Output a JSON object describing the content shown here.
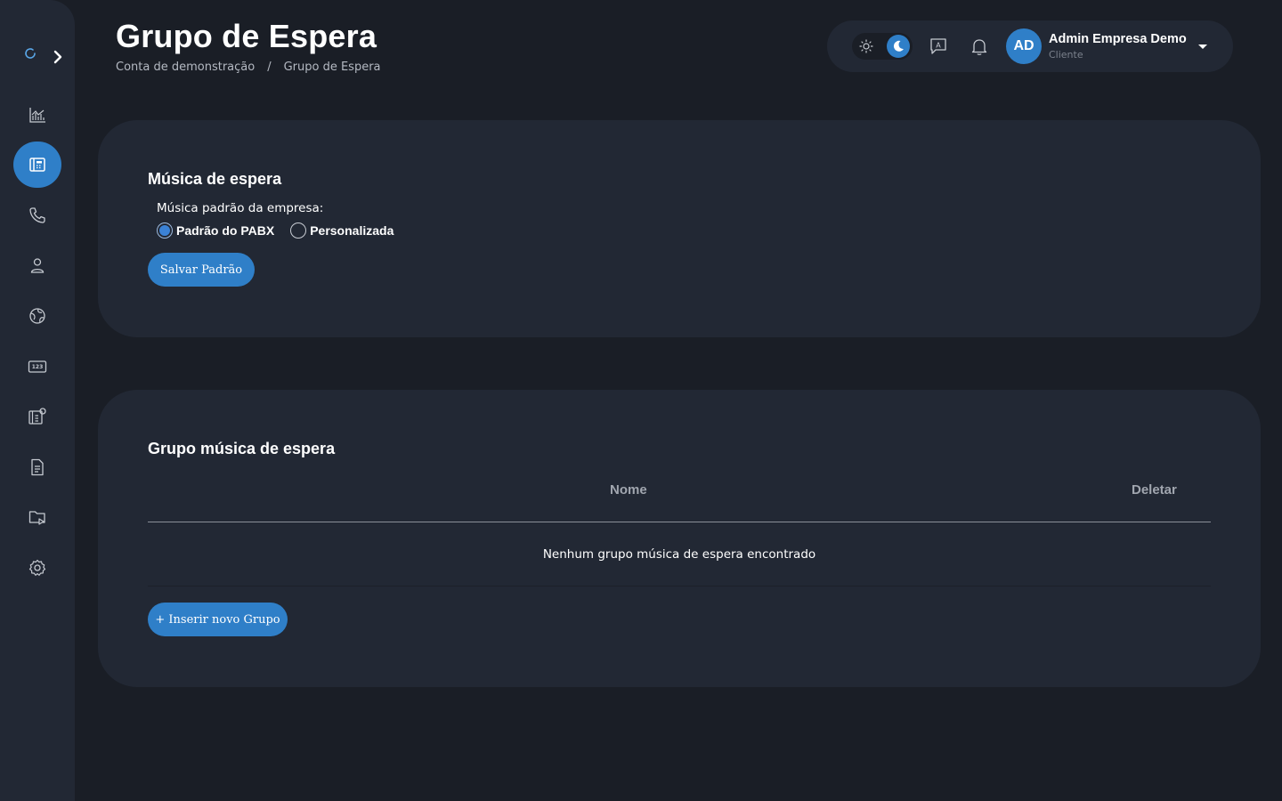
{
  "page": {
    "title": "Grupo de Espera",
    "breadcrumb": [
      "Conta de demonstração",
      "/",
      "Grupo de Espera"
    ]
  },
  "header": {
    "user": {
      "initials": "AD",
      "name": "Admin Empresa Demo",
      "role": "Cliente"
    },
    "theme": {
      "mode": "dark",
      "icons": [
        "sun-icon",
        "moon-icon"
      ]
    },
    "icons": [
      "chat-icon",
      "bell-icon",
      "chevron-down-icon"
    ]
  },
  "sidebar": {
    "items": [
      {
        "icon": "chart-icon",
        "active": false
      },
      {
        "icon": "pbx-icon",
        "active": true
      },
      {
        "icon": "phone-icon",
        "active": false
      },
      {
        "icon": "user-icon",
        "active": false
      },
      {
        "icon": "globe-icon",
        "active": false
      },
      {
        "icon": "numpad-icon",
        "active": false
      },
      {
        "icon": "pbx-settings-icon",
        "active": false
      },
      {
        "icon": "document-icon",
        "active": false
      },
      {
        "icon": "folder-play-icon",
        "active": false
      },
      {
        "icon": "gear-icon",
        "active": false
      }
    ]
  },
  "hold_music": {
    "title": "Música de espera",
    "label": "Música padrão da empresa:",
    "options": [
      {
        "label": "Padrão do PABX",
        "checked": true
      },
      {
        "label": "Personalizada",
        "checked": false
      }
    ],
    "save_label": "Salvar Padrão"
  },
  "hold_groups": {
    "title": "Grupo música de espera",
    "columns": [
      "Nome",
      "Deletar"
    ],
    "empty_text": "Nenhum grupo música de espera encontrado",
    "insert_label": "+ Inserir novo Grupo"
  },
  "colors": {
    "background": "#1a1e26",
    "panel": "#222834",
    "accent": "#2f7fc8"
  }
}
